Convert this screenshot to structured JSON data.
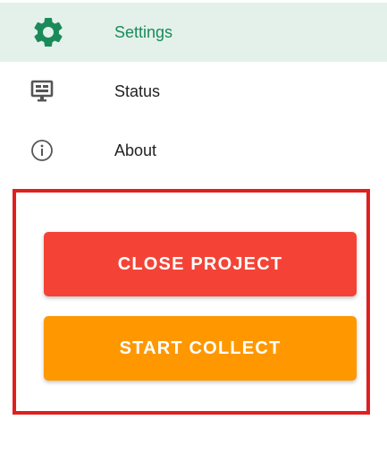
{
  "nav": {
    "items": [
      {
        "label": "Settings",
        "icon": "gear-icon",
        "active": true
      },
      {
        "label": "Status",
        "icon": "monitor-icon",
        "active": false
      },
      {
        "label": "About",
        "icon": "info-icon",
        "active": false
      }
    ]
  },
  "actions": {
    "close_project_label": "CLOSE PROJECT",
    "start_collect_label": "START COLLECT"
  },
  "colors": {
    "active_bg": "#e3f1ea",
    "active_accent": "#1b8a5a",
    "close_button": "#f44336",
    "start_button": "#ff9800",
    "highlight_border": "#e0201f"
  }
}
